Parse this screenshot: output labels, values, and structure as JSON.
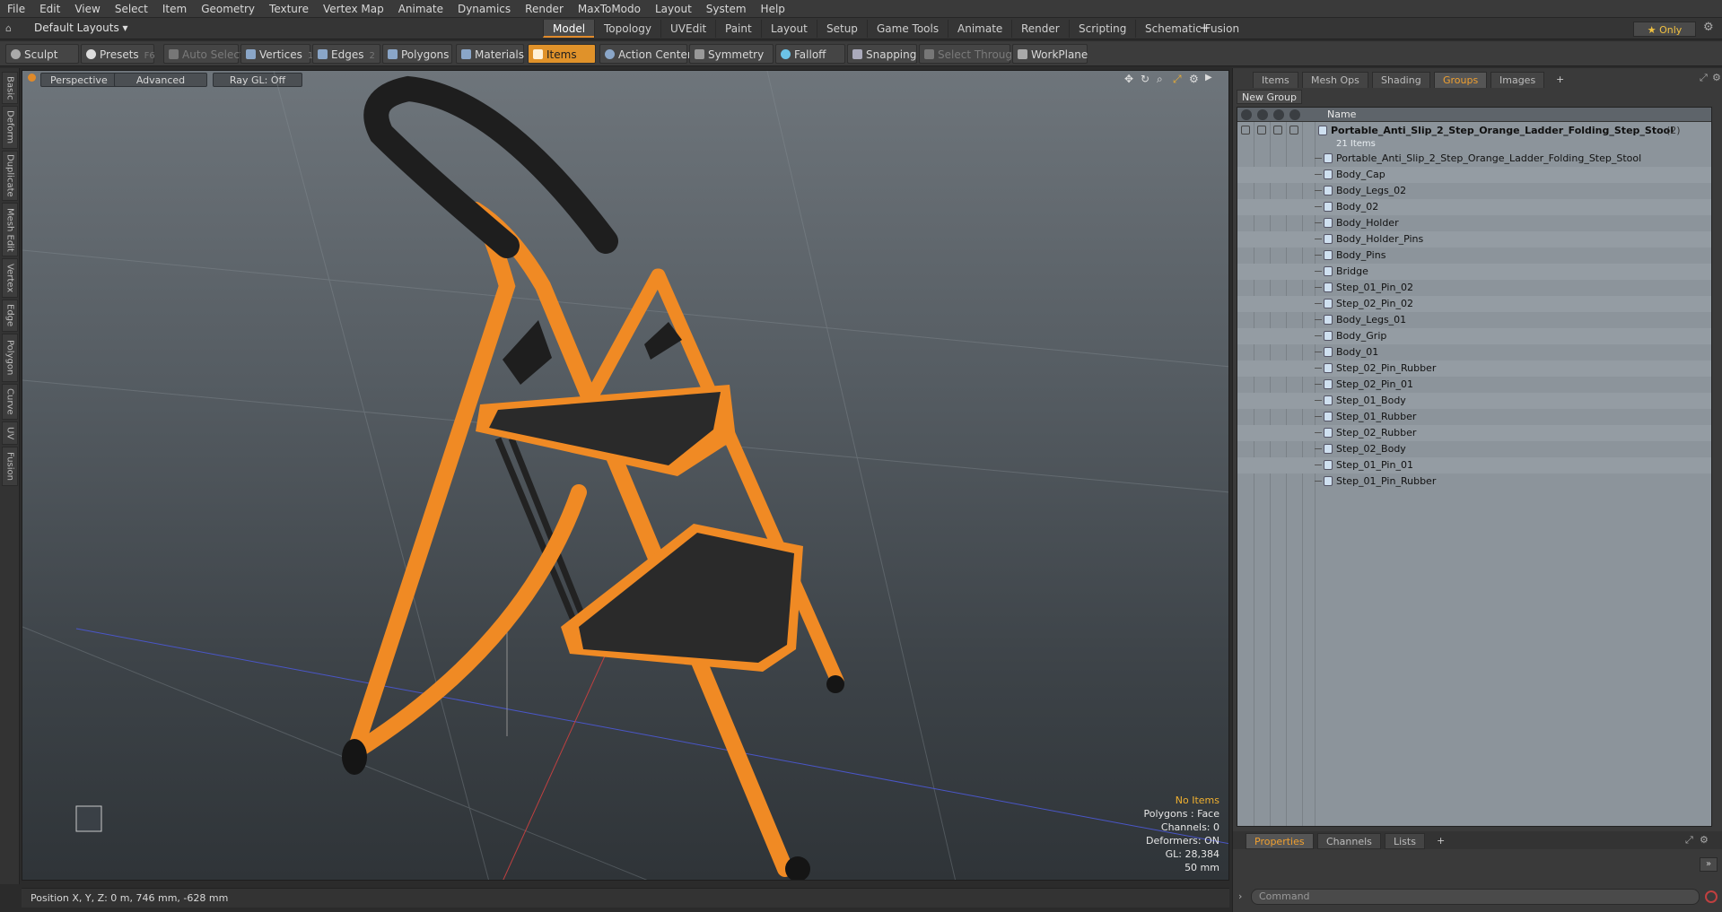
{
  "menu": [
    "File",
    "Edit",
    "View",
    "Select",
    "Item",
    "Geometry",
    "Texture",
    "Vertex Map",
    "Animate",
    "Dynamics",
    "Render",
    "MaxToModo",
    "Layout",
    "System",
    "Help"
  ],
  "layout_selector": "Default Layouts ▾",
  "layout_tabs": [
    "Model",
    "Topology",
    "UVEdit",
    "Paint",
    "Layout",
    "Setup",
    "Game Tools",
    "Animate",
    "Render",
    "Scripting",
    "Schematic Fusion"
  ],
  "layout_add": "+",
  "only_label": "★ Only",
  "toolbar": {
    "sculpt": "Sculpt",
    "presets": "Presets",
    "presets_key": "F6",
    "auto_select": "Auto Select",
    "vertices": "Vertices",
    "vertices_count": "1",
    "edges": "Edges",
    "edges_count": "2",
    "polygons": "Polygons",
    "materials": "Materials",
    "items": "Items",
    "action_center": "Action Center",
    "symmetry": "Symmetry",
    "falloff": "Falloff",
    "snapping": "Snapping",
    "select_through": "Select Through",
    "workplane": "WorkPlane"
  },
  "left_tabs": [
    "Basic",
    "Deform",
    "Duplicate",
    "Mesh Edit",
    "Vertex",
    "Edge",
    "Polygon",
    "Curve",
    "UV",
    "Fusion"
  ],
  "viewport": {
    "perspective": "Perspective",
    "advanced": "Advanced",
    "raygl": "Ray GL: Off",
    "info": {
      "no_items": "No Items",
      "polygons": "Polygons : Face",
      "channels": "Channels: 0",
      "deformers": "Deformers: ON",
      "gl": "GL: 28,384",
      "scale": "50 mm"
    }
  },
  "status": "Position X, Y, Z:   0 m, 746 mm, -628 mm",
  "right_tabs": [
    "Items",
    "Mesh Ops",
    "Shading",
    "Groups",
    "Images"
  ],
  "new_group": "New Group",
  "tree_header_name": "Name",
  "root_item": {
    "name": "Portable_Anti_Slip_2_Step_Orange_Ladder_Folding_Step_Stool",
    "count": "(2)",
    "sub": "21 Items"
  },
  "items": [
    "Portable_Anti_Slip_2_Step_Orange_Ladder_Folding_Step_Stool",
    "Body_Cap",
    "Body_Legs_02",
    "Body_02",
    "Body_Holder",
    "Body_Holder_Pins",
    "Body_Pins",
    "Bridge",
    "Step_01_Pin_02",
    "Step_02_Pin_02",
    "Body_Legs_01",
    "Body_Grip",
    "Body_01",
    "Step_02_Pin_Rubber",
    "Step_02_Pin_01",
    "Step_01_Body",
    "Step_01_Rubber",
    "Step_02_Rubber",
    "Step_02_Body",
    "Step_01_Pin_01",
    "Step_01_Pin_Rubber"
  ],
  "bottom_tabs": [
    "Properties",
    "Channels",
    "Lists"
  ],
  "command_placeholder": "Command",
  "colors": {
    "accent": "#e0922a",
    "ladder_orange": "#f08a24",
    "grip_black": "#1e1e1e"
  }
}
